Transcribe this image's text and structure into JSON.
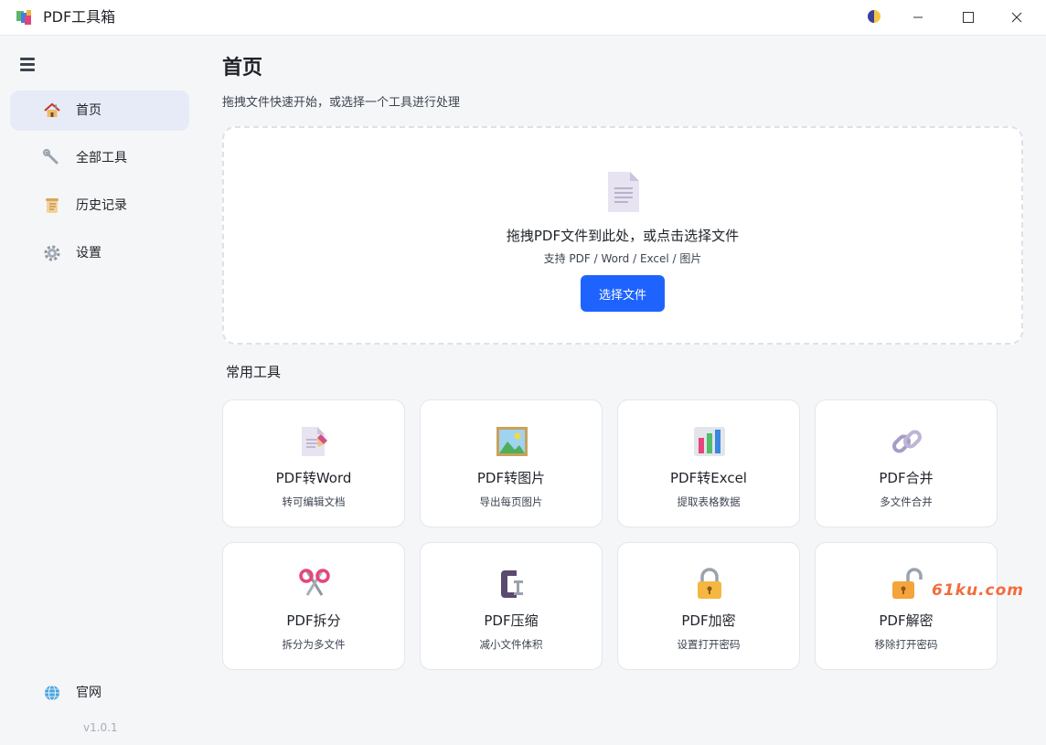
{
  "app": {
    "title": "PDF工具箱",
    "icons": {
      "logo": "app-logo-icon",
      "theme": "theme-toggle-icon",
      "minimize": "minimize-icon",
      "maximize": "maximize-icon",
      "close": "close-icon"
    }
  },
  "sidebar": {
    "toggle_icon": "hamburger-menu-icon",
    "items": [
      {
        "label": "首页",
        "icon": "home-icon",
        "active": true
      },
      {
        "label": "全部工具",
        "icon": "wrench-icon",
        "active": false
      },
      {
        "label": "历史记录",
        "icon": "scroll-icon",
        "active": false
      },
      {
        "label": "设置",
        "icon": "gear-icon",
        "active": false
      }
    ],
    "footer": {
      "label": "官网",
      "icon": "globe-icon"
    },
    "version": "v1.0.1"
  },
  "main": {
    "title": "首页",
    "subtitle": "拖拽文件快速开始，或选择一个工具进行处理",
    "dropzone": {
      "icon": "document-icon",
      "title": "拖拽PDF文件到此处，或点击选择文件",
      "hint": "支持 PDF / Word / Excel / 图片",
      "button_label": "选择文件"
    },
    "section_title": "常用工具",
    "tools": [
      {
        "name": "PDF转Word",
        "desc": "转可编辑文档",
        "icon": "document-edit-icon"
      },
      {
        "name": "PDF转图片",
        "desc": "导出每页图片",
        "icon": "picture-icon"
      },
      {
        "name": "PDF转Excel",
        "desc": "提取表格数据",
        "icon": "bar-chart-icon"
      },
      {
        "name": "PDF合并",
        "desc": "多文件合并",
        "icon": "link-icon"
      },
      {
        "name": "PDF拆分",
        "desc": "拆分为多文件",
        "icon": "scissors-icon"
      },
      {
        "name": "PDF压缩",
        "desc": "减小文件体积",
        "icon": "clamp-icon"
      },
      {
        "name": "PDF加密",
        "desc": "设置打开密码",
        "icon": "lock-icon"
      },
      {
        "name": "PDF解密",
        "desc": "移除打开密码",
        "icon": "unlock-icon"
      }
    ]
  },
  "watermark": "61ku.com",
  "colors": {
    "accent": "#1f63ff",
    "active_nav_bg": "#e6ebf7",
    "background": "#f5f6f8"
  }
}
